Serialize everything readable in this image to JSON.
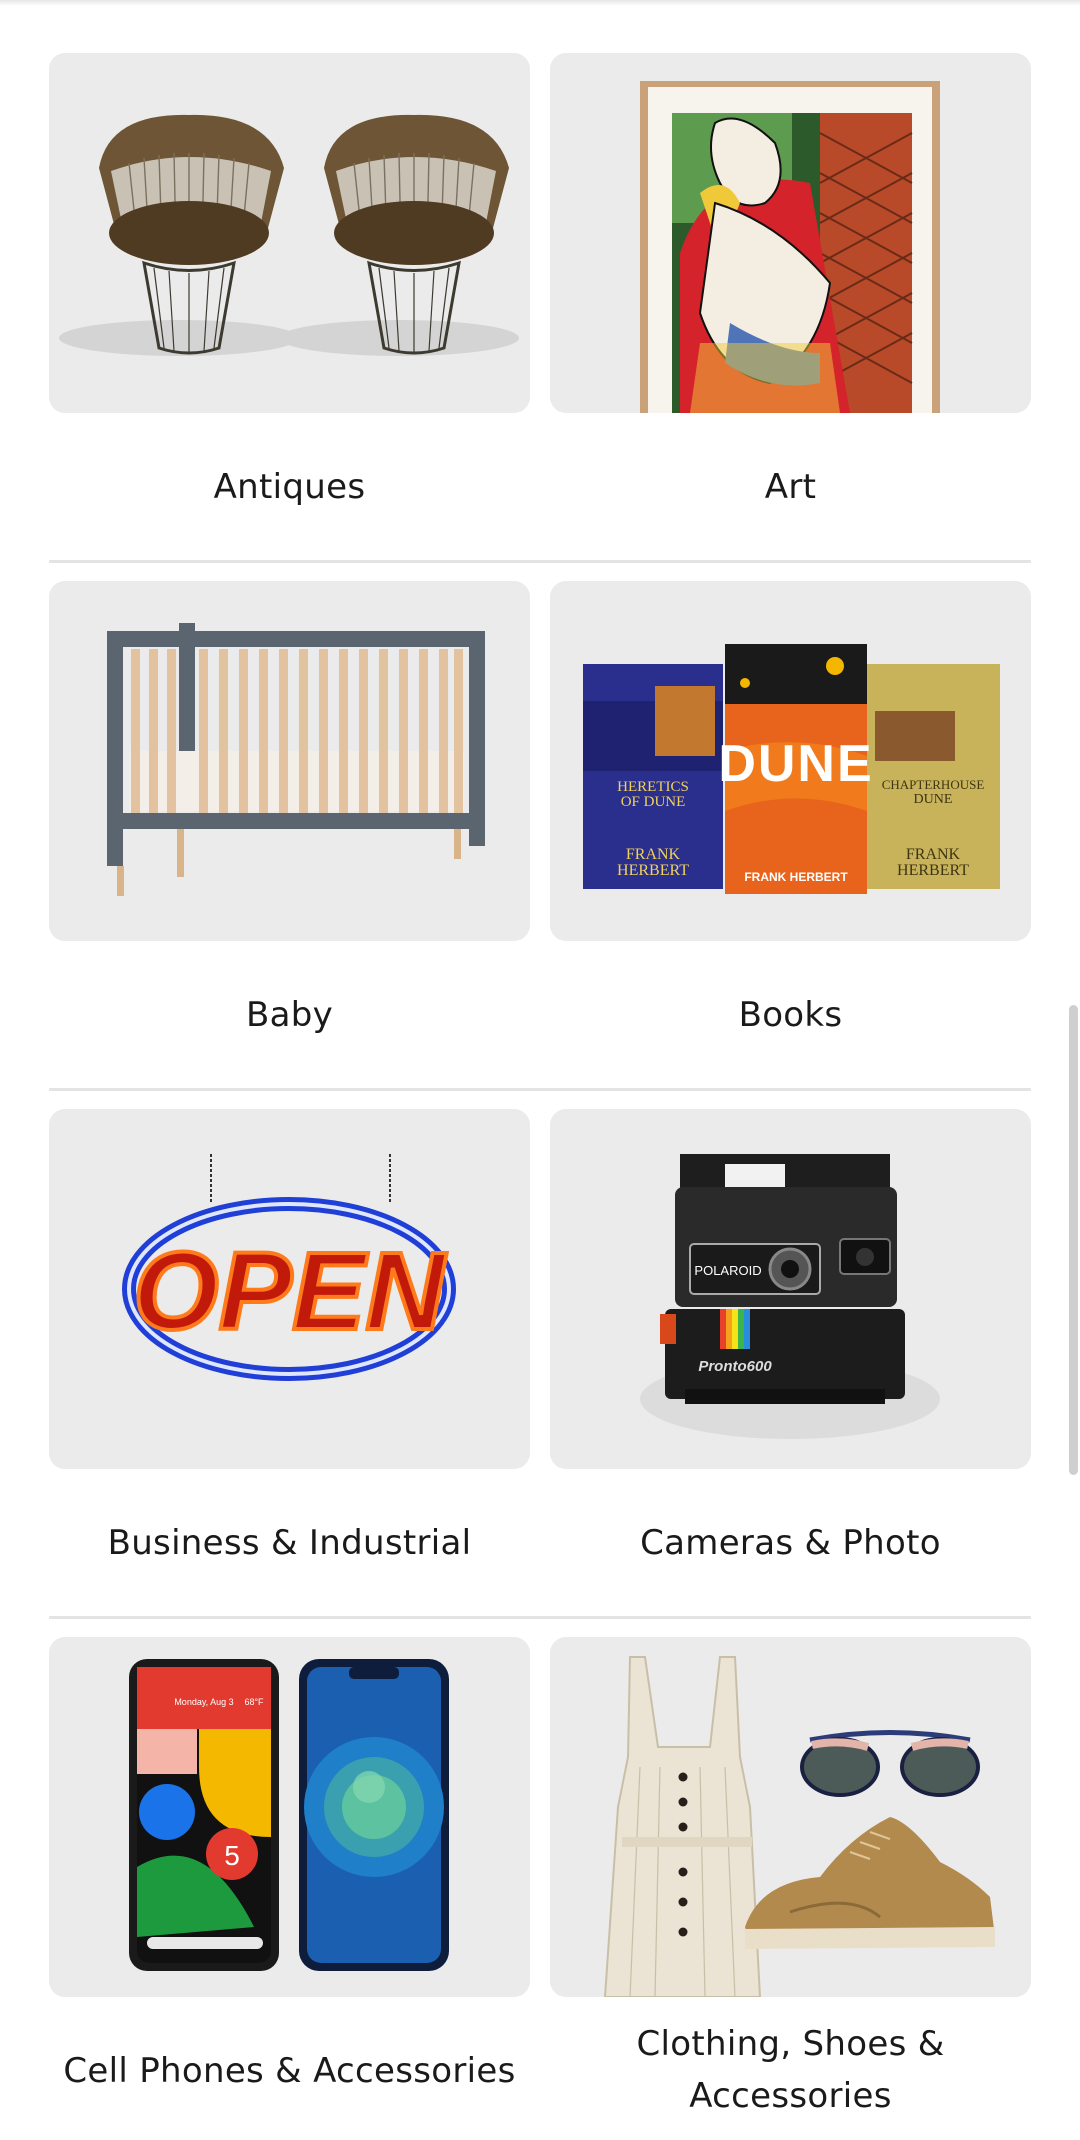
{
  "categories": [
    {
      "label": "Antiques",
      "image": "platner-chairs"
    },
    {
      "label": "Art",
      "image": "picasso-print"
    },
    {
      "label": "Baby",
      "image": "grey-crib"
    },
    {
      "label": "Books",
      "image": "dune-books"
    },
    {
      "label": "Business & Industrial",
      "image": "open-neon-sign"
    },
    {
      "label": "Cameras & Photo",
      "image": "polaroid-camera"
    },
    {
      "label": "Cell Phones & Accessories",
      "image": "smartphones"
    },
    {
      "label": "Clothing, Shoes & Accessories",
      "image": "dress-sunglasses-sneakers"
    }
  ],
  "images": {
    "books": {
      "book1_line1": "HERETICS",
      "book1_line2": "OF DUNE",
      "book1_author1": "FRANK",
      "book1_author2": "HERBERT",
      "book2_title": "DUNE",
      "book2_author": "FRANK HERBERT",
      "book3_line1": "CHAPTERHOUSE",
      "book3_line2": "DUNE",
      "book3_author1": "FRANK",
      "book3_author2": "HERBERT"
    },
    "neon": {
      "text": "OPEN"
    },
    "camera": {
      "brand": "POLAROID",
      "model": "Pronto600"
    },
    "phone": {
      "date": "Monday, Aug 3",
      "temp": "68°F",
      "badge": "5"
    }
  },
  "colors": {
    "tile_bg": "#ebebeb",
    "text": "#1a1a1a",
    "divider": "#e4e4e4"
  }
}
